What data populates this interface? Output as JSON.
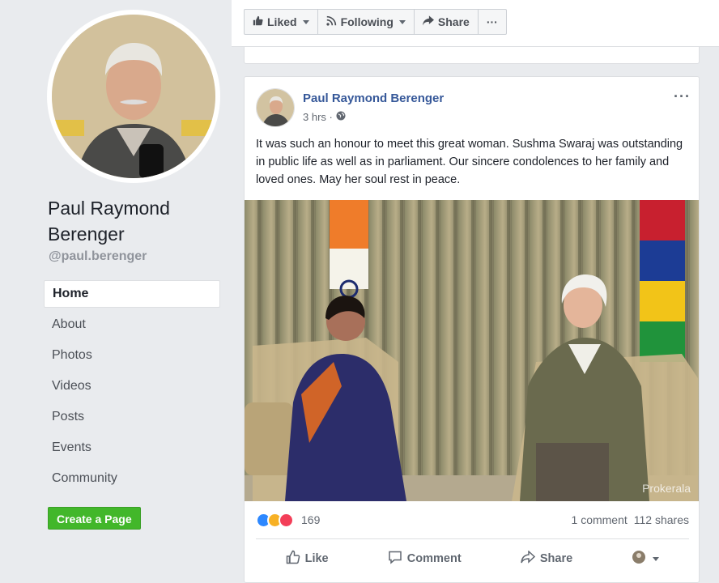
{
  "page": {
    "name": "Paul Raymond Berenger",
    "handle": "@paul.berenger"
  },
  "nav": {
    "items": [
      "Home",
      "About",
      "Photos",
      "Videos",
      "Posts",
      "Events",
      "Community"
    ],
    "active": "Home"
  },
  "create_page_label": "Create a Page",
  "toolbar": {
    "liked_label": "Liked",
    "following_label": "Following",
    "share_label": "Share",
    "more_label": "···"
  },
  "post": {
    "author": "Paul Raymond Berenger",
    "time": "3 hrs ·",
    "text": "It was such an honour to meet this great woman. Sushma Swaraj was outstanding in public life as well as in parliament. Our sincere condolences to her family and loved ones. May her soul rest in peace.",
    "photo_watermark": "Prokerala",
    "reaction_count": "169",
    "comments": "1 comment",
    "shares": "112 shares",
    "actions": {
      "like": "Like",
      "comment": "Comment",
      "share": "Share"
    },
    "more_label": "···"
  },
  "colors": {
    "link": "#365899",
    "green_button": "#42b72a",
    "background": "#e9ebee"
  }
}
